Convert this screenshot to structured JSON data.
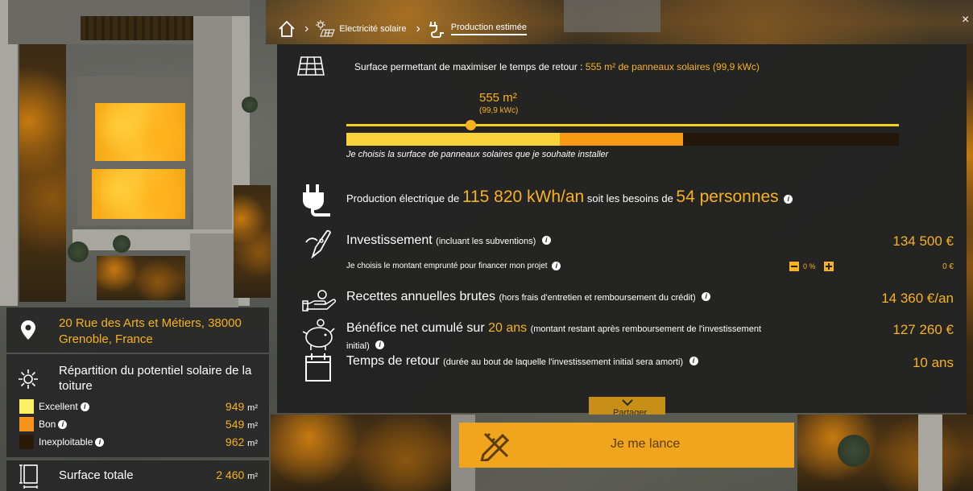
{
  "breadcrumb": {
    "home_label": "Accueil",
    "items": [
      {
        "label": "Electricité solaire"
      },
      {
        "label": "Production estimée"
      }
    ]
  },
  "surface": {
    "text_prefix": "Surface permettant de maximiser le temps de retour :",
    "text_highlight": "555 m² de panneaux solaires",
    "text_suffix": "(99,9 kWc)",
    "slider_value_label": "555 m²",
    "slider_value_sub": "(99,9 kWc)",
    "slider_fraction": 0.227,
    "helper_text": "Je choisis la surface de panneaux solaires que je souhaite installer",
    "bar_segments": [
      {
        "label": "Excellent",
        "color": "#f8d33a",
        "fraction": 0.387
      },
      {
        "label": "Bon",
        "color": "#f99a12",
        "fraction": 0.224
      },
      {
        "label": "Inexploitable",
        "color": "#221709",
        "fraction": 0.389
      }
    ]
  },
  "production": {
    "prefix": "Production électrique de",
    "value": "115 820 kWh/an",
    "middle": "soit les besoins de",
    "persons": "54 personnes"
  },
  "investissement": {
    "title": "Investissement",
    "subtitle": "(incluant les subventions)",
    "value": "134 500 €",
    "loan_label": "Je choisis le montant emprunté pour financer mon projet",
    "loan_percent": "0 %",
    "loan_value": "0 €"
  },
  "recettes": {
    "title": "Recettes annuelles brutes",
    "subtitle": "(hors frais d'entretien et remboursement du crédit)",
    "value": "14 360 €/an"
  },
  "benefice": {
    "title_prefix": "Bénéfice net cumulé sur",
    "years": "20 ans",
    "subtitle": "(montant restant après remboursement de l'investissement initial)",
    "value": "127 260 €"
  },
  "retour": {
    "title": "Temps de retour",
    "subtitle": "(durée au bout de laquelle l'investissement initial sera amorti)",
    "value": "10 ans"
  },
  "address": {
    "text": "20 Rue des Arts et Métiers, 38000 Grenoble, France"
  },
  "repartition": {
    "title": "Répartition du potentiel solaire de la toiture",
    "unit": "m²",
    "items": [
      {
        "label": "Excellent",
        "value": "949",
        "color": "#faf063"
      },
      {
        "label": "Bon",
        "value": "549",
        "color": "#f7931a"
      },
      {
        "label": "Inexploitable",
        "value": "962",
        "color": "#2a1a08"
      }
    ]
  },
  "total": {
    "label": "Surface totale",
    "value": "2 460",
    "unit": "m²"
  },
  "cta": {
    "label": "Je me lance"
  },
  "share": {
    "label": "Partager"
  },
  "colors": {
    "accent": "#f8b21f",
    "panel": "#222222",
    "cta": "#f0a51d"
  }
}
